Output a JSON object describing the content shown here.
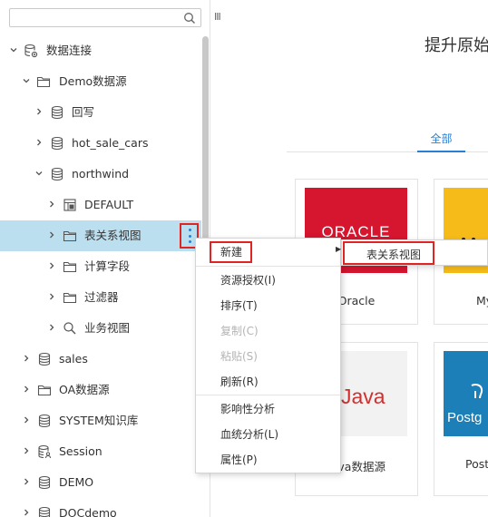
{
  "sidebar": {
    "search": {
      "placeholder": "",
      "value": ""
    },
    "tree": [
      {
        "label": "数据连接",
        "icon": "database-connection-icon",
        "expanded": true
      },
      {
        "label": "Demo数据源",
        "icon": "folder-icon",
        "expanded": true
      },
      {
        "label": "回写",
        "icon": "database-icon",
        "expanded": false
      },
      {
        "label": "hot_sale_cars",
        "icon": "database-icon",
        "expanded": false
      },
      {
        "label": "northwind",
        "icon": "database-icon",
        "expanded": true
      },
      {
        "label": "DEFAULT",
        "icon": "schema-table-icon",
        "expanded": false
      },
      {
        "label": "表关系视图",
        "icon": "folder-icon",
        "expanded": false,
        "selected": true
      },
      {
        "label": "计算字段",
        "icon": "folder-icon",
        "expanded": false
      },
      {
        "label": "过滤器",
        "icon": "folder-icon",
        "expanded": false
      },
      {
        "label": "业务视图",
        "icon": "search-icon",
        "expanded": false
      },
      {
        "label": "sales",
        "icon": "database-icon",
        "expanded": false
      },
      {
        "label": "OA数据源",
        "icon": "folder-icon",
        "expanded": false
      },
      {
        "label": "SYSTEM知识库",
        "icon": "database-icon",
        "expanded": false
      },
      {
        "label": "Session",
        "icon": "database-user-icon",
        "expanded": false
      },
      {
        "label": "DEMO",
        "icon": "database-icon",
        "expanded": false
      },
      {
        "label": "DOCdemo",
        "icon": "database-icon",
        "expanded": false
      }
    ]
  },
  "main": {
    "resize_handle": "III",
    "promo_title": "提升原始",
    "tabs": [
      {
        "label": "全部",
        "active": true
      }
    ],
    "cards": [
      {
        "name": "Oracle",
        "logo_text": "ORACLE",
        "logo_bg": "#d6152f"
      },
      {
        "name": "My",
        "logo_text": "",
        "logo_bg": "#f6bb18"
      },
      {
        "name": "Java数据源",
        "logo_text": "Java",
        "logo_bg": "#f2f2f2"
      },
      {
        "name": "Poste",
        "logo_text": "Postg",
        "logo_bg": "#1c7fb8"
      }
    ]
  },
  "context_menu": {
    "items": [
      {
        "label": "新建",
        "has_submenu": true,
        "disabled": false
      },
      {
        "label": "资源授权(I)",
        "disabled": false
      },
      {
        "label": "排序(T)",
        "disabled": false
      },
      {
        "label": "复制(C)",
        "disabled": true
      },
      {
        "label": "粘贴(S)",
        "disabled": true
      },
      {
        "label": "刷新(R)",
        "disabled": false
      },
      {
        "label": "影响性分析",
        "disabled": false
      },
      {
        "label": "血统分析(L)",
        "disabled": false
      },
      {
        "label": "属性(P)",
        "disabled": false
      }
    ],
    "submenu": {
      "items": [
        {
          "label": "表关系视图"
        }
      ]
    }
  },
  "colors": {
    "accent": "#2a7fd4",
    "selected_row": "#bcdff0",
    "highlight_border": "#e02424",
    "icon": "#555555"
  }
}
